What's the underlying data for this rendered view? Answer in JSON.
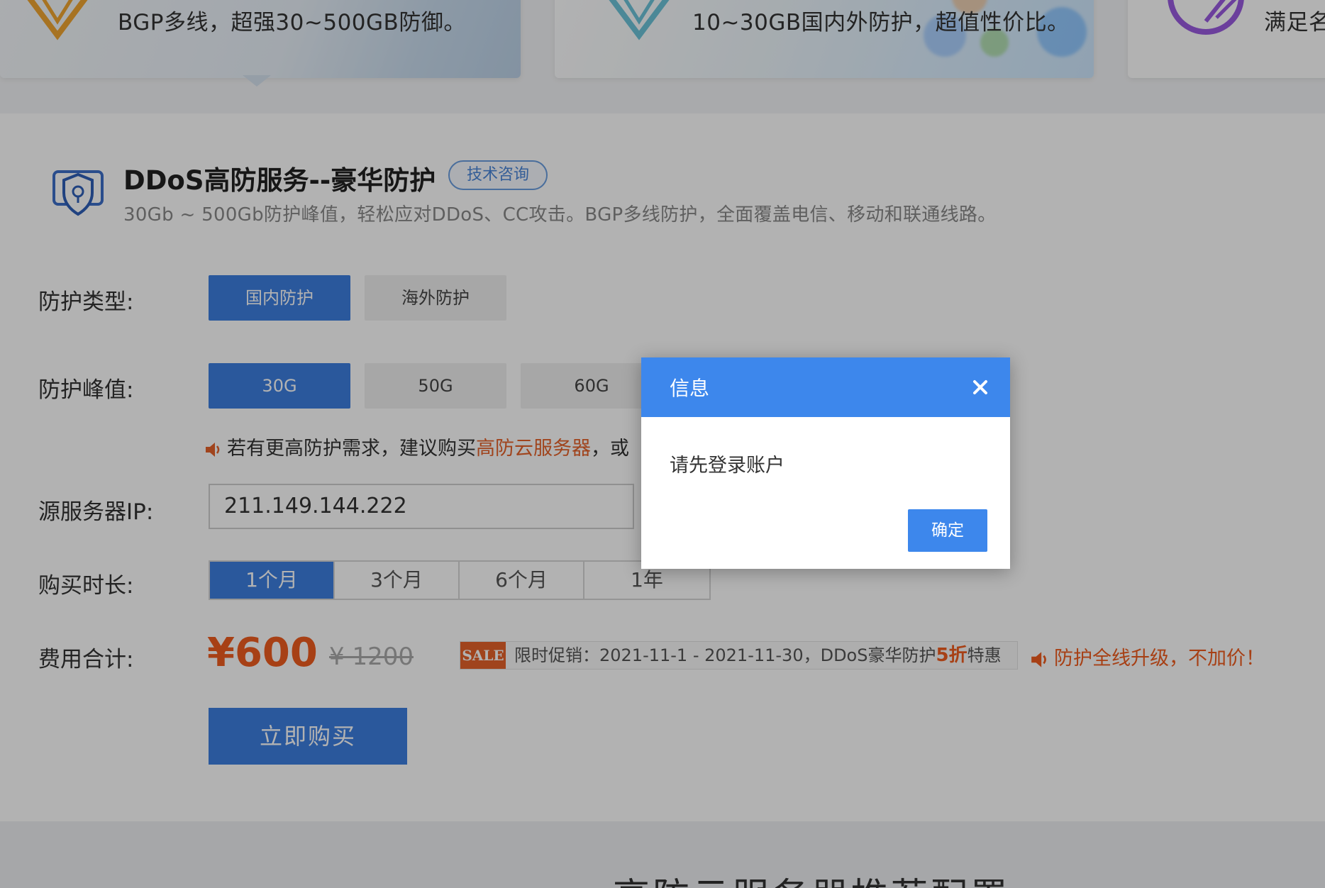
{
  "cards": [
    {
      "desc": "BGP多线，超强30~500GB防御。"
    },
    {
      "desc": "10~30GB国内外防护，超值性价比。"
    },
    {
      "desc": "满足名"
    }
  ],
  "service": {
    "title": "DDoS高防服务--豪华防护",
    "consult_label": "技术咨询",
    "subtitle": "30Gb ~ 500Gb防护峰值，轻松应对DDoS、CC攻击。BGP多线防护，全面覆盖电信、移动和联通线路。"
  },
  "protection_type": {
    "label": "防护类型:",
    "options": [
      "国内防护",
      "海外防护"
    ],
    "selected": "国内防护"
  },
  "protection_peak": {
    "label": "防护峰值:",
    "options": [
      "30G",
      "50G",
      "60G"
    ],
    "selected": "30G"
  },
  "tip": {
    "prefix": "若有更高防护需求，建议购买",
    "link": "高防云服务器",
    "suffix": "，或"
  },
  "source_ip": {
    "label": "源服务器IP:",
    "value": "211.149.144.222"
  },
  "duration": {
    "label": "购买时长:",
    "options": [
      "1个月",
      "3个月",
      "6个月",
      "1年"
    ],
    "selected": "1个月"
  },
  "cost": {
    "label": "费用合计:",
    "price": "¥600",
    "old_price": "¥ 1200",
    "sale_tag": "SALE",
    "sale_prefix": "限时促销：2021-11-1 - 2021-11-30，DDoS豪华防护",
    "sale_discount": "5折",
    "sale_suffix": "特惠",
    "upgrade_note": "防护全线升级，不加价！"
  },
  "buy_label": "立即购买",
  "bottom_title": "高防云服务器推荐配置",
  "dialog": {
    "title": "信息",
    "message": "请先登录账户",
    "ok_label": "确定"
  },
  "colors": {
    "primary": "#3d7ee0",
    "dialog_header": "#3d87ec",
    "accent_orange": "#ef5c1f",
    "overlay": "rgba(0,0,0,0.30)"
  }
}
